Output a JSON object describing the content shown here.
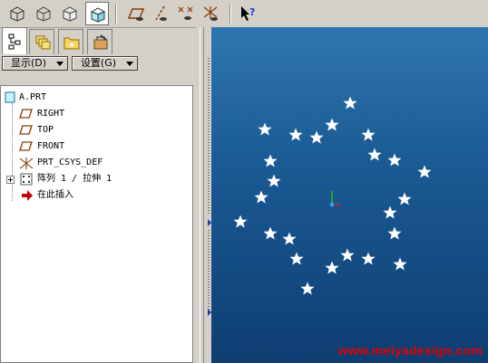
{
  "navigator": {
    "show_menu": "显示(D)",
    "settings_menu": "设置(G)"
  },
  "tree": {
    "root": "A.PRT",
    "items": [
      "RIGHT",
      "TOP",
      "FRONT",
      "PRT_CSYS_DEF",
      "阵列 1 / 拉伸 1",
      "在此插入"
    ]
  },
  "viewport": {
    "watermark": "www.meiyadesign.com",
    "background_top": "#2f76b0",
    "background_bottom": "#0e3e72",
    "star_count": 29
  },
  "colors": {
    "watermark": "#e00000",
    "insert_arrow": "#c00000",
    "datum_plane": "#8a3a00",
    "selected_tool": "#ffffff"
  },
  "icons": {
    "toolbar": [
      "wireframe-cube-icon",
      "hidden-line-cube-icon",
      "no-hidden-cube-icon",
      "shaded-cube-icon",
      "datum-plane-display-icon",
      "datum-axis-display-icon",
      "datum-point-display-icon",
      "coordinate-system-display-icon",
      "context-help-icon"
    ],
    "nav_tabs": [
      "model-tree-icon",
      "layer-tree-icon",
      "folder-browser-icon",
      "favorites-icon"
    ]
  }
}
